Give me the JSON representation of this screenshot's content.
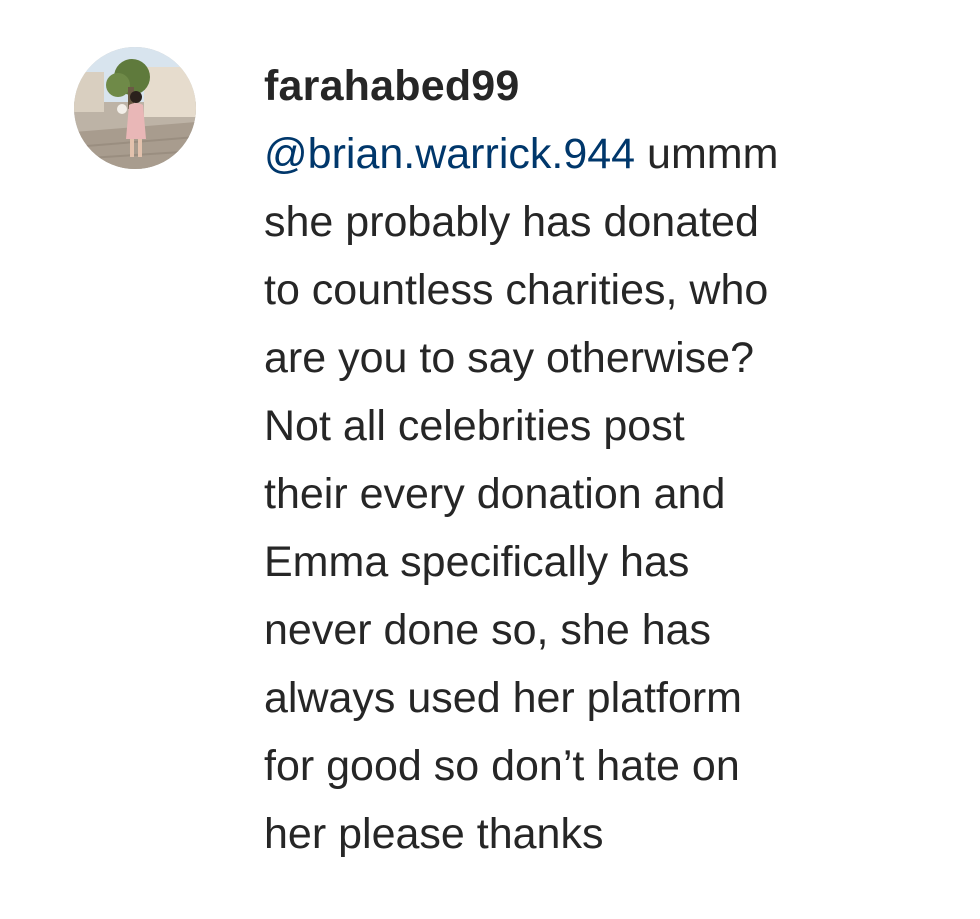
{
  "comment": {
    "username": "farahabed99",
    "mention": "@brian.warrick.944",
    "first_line_rest": " ummm",
    "lines": [
      "she probably has donated",
      "to countless charities, who",
      "are you to say otherwise?",
      "Not all celebrities post",
      "their every donation and",
      "Emma specifically has",
      "never done so, she has",
      "always used her platform",
      "for good so don’t hate on",
      "her please thanks"
    ]
  },
  "colors": {
    "text": "#262626",
    "mention": "#00376b",
    "background": "#ffffff"
  }
}
